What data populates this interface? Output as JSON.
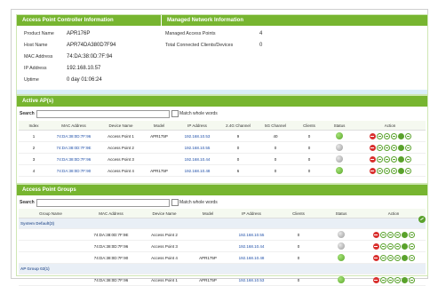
{
  "controller_info": {
    "title": "Access Point Controller Information",
    "rows": [
      {
        "label": "Product Name",
        "value": "APR176P"
      },
      {
        "label": "Host Name",
        "value": "APR74DA380D7F94"
      },
      {
        "label": "MAC Address",
        "value": "74:DA:38:0D:7F:94"
      },
      {
        "label": "IP Address",
        "value": "192.168.10.57"
      },
      {
        "label": "Uptime",
        "value": "0 day 01:06:24"
      }
    ]
  },
  "managed_info": {
    "title": "Managed Network Information",
    "rows": [
      {
        "label": "Managed Access Points",
        "value": "4"
      },
      {
        "label": "Total Connected Clients/Devices",
        "value": "0"
      }
    ]
  },
  "active_aps": {
    "title": "Active AP(s)",
    "search_label": "Search",
    "search_value": "",
    "match_whole_words": "Match whole words",
    "columns": [
      "Index",
      "MAC Address",
      "Device Name",
      "Model",
      "IP Address",
      "2.4G Channel",
      "5G Channel",
      "Clients",
      "Status",
      "Action"
    ],
    "rows": [
      {
        "index": "1",
        "mac": "74:DA:38:0D:7F:96",
        "name": "Access Point 1",
        "model": "APR175P",
        "ip": "192.168.10.53",
        "ch24": "9",
        "ch5": "40",
        "clients": "0",
        "status": "online"
      },
      {
        "index": "2",
        "mac": "74:DA:38:0D:7F:9E",
        "name": "Access Point 2",
        "model": "",
        "ip": "192.168.10.55",
        "ch24": "0",
        "ch5": "0",
        "clients": "0",
        "status": "offline"
      },
      {
        "index": "3",
        "mac": "74:DA:38:0D:7F:96",
        "name": "Access Point 3",
        "model": "",
        "ip": "192.168.10.44",
        "ch24": "0",
        "ch5": "0",
        "clients": "0",
        "status": "offline"
      },
      {
        "index": "4",
        "mac": "74:DA:38:0D:7F:90",
        "name": "Access Point 4",
        "model": "APR175P",
        "ip": "192.168.10.48",
        "ch24": "6",
        "ch5": "0",
        "clients": "0",
        "status": "online"
      }
    ]
  },
  "ap_groups": {
    "title": "Access Point Groups",
    "search_label": "Search",
    "search_value": "",
    "match_whole_words": "Match whole words",
    "columns": [
      "Group Name",
      "MAC Address",
      "Device Name",
      "Model",
      "IP Address",
      "Clients",
      "Status",
      "Action"
    ],
    "groups": [
      {
        "name": "System Default(3)",
        "rows": [
          {
            "mac": "74:DA:38:0D:7F:9E",
            "name": "Access Point 2",
            "model": "",
            "ip": "192.168.10.55",
            "clients": "0",
            "status": "offline"
          },
          {
            "mac": "74:DA:38:0D:7F:96",
            "name": "Access Point 3",
            "model": "",
            "ip": "192.168.10.44",
            "clients": "0",
            "status": "offline"
          },
          {
            "mac": "74:DA:38:0D:7F:90",
            "name": "Access Point 4",
            "model": "APR175P",
            "ip": "192.168.10.48",
            "clients": "0",
            "status": "online"
          }
        ]
      },
      {
        "name": "AP Group 02(1)",
        "rows": [
          {
            "mac": "74:DA:38:0D:7F:96",
            "name": "Access Point 1",
            "model": "APR175P",
            "ip": "192.168.10.53",
            "clients": "0",
            "status": "online"
          }
        ]
      }
    ]
  },
  "colors": {
    "header_green": "#77b530",
    "link_blue": "#1f4fa8",
    "online": "#58a626",
    "offline": "#9a9a9a",
    "action_red": "#d9302e"
  },
  "icons": [
    "remove-icon",
    "wrench-icon",
    "edit-icon",
    "refresh-icon",
    "network-icon",
    "ap-group-icon",
    "online-status-icon",
    "offline-status-icon",
    "add-group-icon"
  ]
}
